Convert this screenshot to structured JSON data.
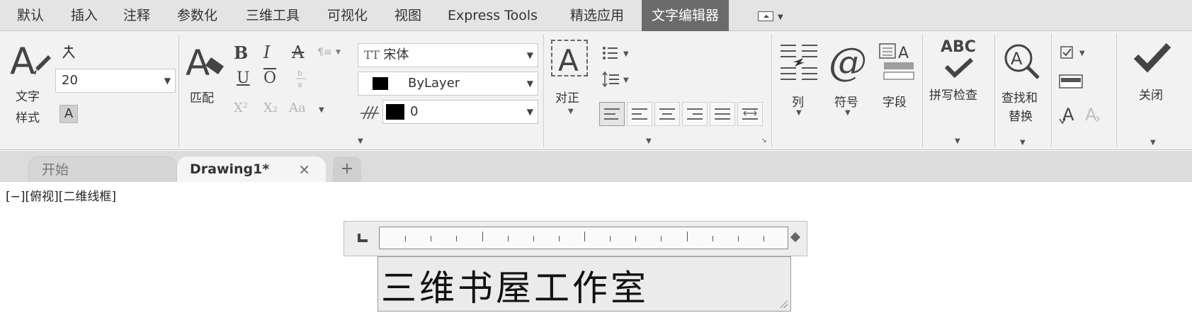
{
  "menu": {
    "tabs": [
      "默认",
      "插入",
      "注释",
      "参数化",
      "三维工具",
      "可视化",
      "视图",
      "Express Tools",
      "精选应用",
      "文字编辑器"
    ],
    "active_tab": "文字编辑器"
  },
  "ribbon": {
    "style": {
      "label_line1": "文字",
      "label_line2": "样式",
      "height_value": "20",
      "mask_button": "A"
    },
    "formatting": {
      "match_label": "匹配",
      "bold": "B",
      "italic": "I",
      "strike": "A",
      "underline": "U",
      "overline": "O",
      "superscript": "X²",
      "subscript": "X₂",
      "case": "Aa",
      "font_value": "宋体",
      "color_value": "ByLayer",
      "oblique_value": "0"
    },
    "paragraph": {
      "justify_label": "对正"
    },
    "insert": {
      "columns_label": "列",
      "symbol_label": "符号",
      "field_label": "字段"
    },
    "spell": {
      "abc": "ABC",
      "label": "拼写检查"
    },
    "tools": {
      "find_label_line1": "查找和",
      "find_label_line2": "替换"
    },
    "close": {
      "label": "关闭"
    }
  },
  "file_tabs": {
    "start": "开始",
    "drawing": "Drawing1*",
    "close_glyph": "×",
    "add_glyph": "+"
  },
  "canvas": {
    "viewport_label": "[−][俯视][二维线框]",
    "editor_text": "三维书屋工作室"
  }
}
